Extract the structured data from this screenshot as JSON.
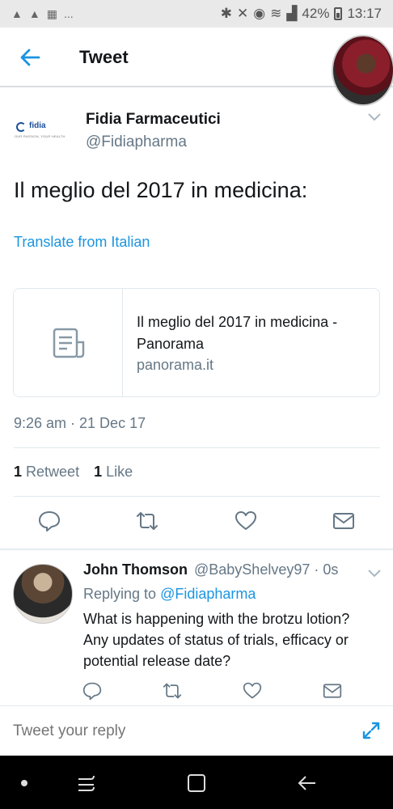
{
  "status_bar": {
    "notification_icons": [
      "upload-icon",
      "upload-icon",
      "qr-code-icon"
    ],
    "more": "...",
    "icons": [
      "bluetooth-icon",
      "mute-icon",
      "alarm-icon",
      "wifi-icon",
      "signal-icon"
    ],
    "battery": "42%",
    "time": "13:17"
  },
  "app_bar": {
    "title": "Tweet"
  },
  "tweet": {
    "author_name": "Fidia Farmaceutici",
    "author_handle": "@Fidiapharma",
    "brand_logo": {
      "name": "fidia",
      "tagline": "OUR PASSION, YOUR HEALTH"
    },
    "text": "Il meglio del 2017 in medicina:",
    "translate_label": "Translate from Italian",
    "card": {
      "title": "Il meglio del 2017 in medicina - Panorama",
      "domain": "panorama.it"
    },
    "timestamp": "9:26 am · 21 Dec 17",
    "retweets_count": "1",
    "retweets_label": "Retweet",
    "likes_count": "1",
    "likes_label": "Like"
  },
  "reply": {
    "author_name": "John Thomson",
    "meta": "@BabyShelvey97 · 0s",
    "replying_prefix": "Replying to",
    "replying_handle": "@Fidiapharma",
    "text": "What is happening with the brotzu lotion? Any updates of status of trials, efficacy or potential release date?"
  },
  "compose": {
    "placeholder": "Tweet your reply"
  },
  "colors": {
    "accent": "#1b95e0",
    "secondary_text": "#657786",
    "divider": "#e1e8ed"
  }
}
